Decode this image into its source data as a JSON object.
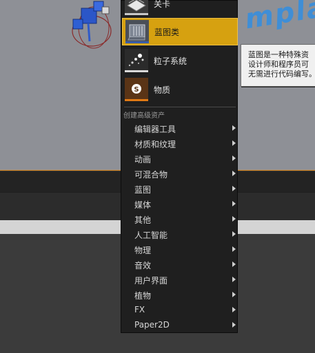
{
  "viewport": {
    "watermark_text": "mpla"
  },
  "menu": {
    "assets": [
      {
        "label": "关卡",
        "icon": "level-icon",
        "stripe_color": "#c8c8c8"
      },
      {
        "label": "蓝图类",
        "icon": "blueprint-class-icon",
        "stripe_color": "#3b5ea8",
        "selected": true
      },
      {
        "label": "粒子系统",
        "icon": "particle-system-icon",
        "stripe_color": "#d9d9d9"
      },
      {
        "label": "物质",
        "icon": "material-icon",
        "stripe_color": "#e07a14"
      }
    ],
    "section_header": "创建高级资产",
    "categories": [
      "编辑器工具",
      "材质和纹理",
      "动画",
      "可混合物",
      "蓝图",
      "媒体",
      "其他",
      "人工智能",
      "物理",
      "音效",
      "用户界面",
      "植物",
      "FX",
      "Paper2D"
    ]
  },
  "tooltip": {
    "lines": [
      "蓝图是一种特殊资",
      "设计师和程序员可",
      "无需进行代码编写。"
    ]
  },
  "colors": {
    "selection": "#d6a110",
    "menu_bg": "#1f1f1f",
    "viewport_bg": "#8e9096",
    "viewport_border": "#e08a1e"
  }
}
